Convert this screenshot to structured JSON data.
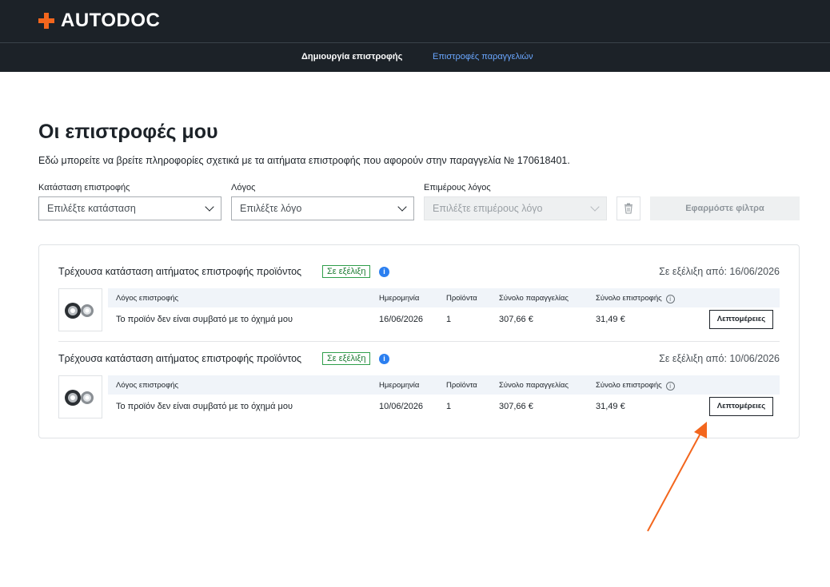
{
  "header": {
    "brand": "AUTODOC",
    "nav": {
      "create_return": "Δημιουργία επιστροφής",
      "order_returns": "Επιστροφές παραγγελιών"
    }
  },
  "page": {
    "title": "Οι επιστροφές μου",
    "description": "Εδώ μπορείτε να βρείτε πληροφορίες σχετικά με τα αιτήματα επιστροφής που αφορούν στην παραγγελία № 170618401."
  },
  "filters": {
    "status_label": "Κατάσταση επιστροφής",
    "status_placeholder": "Επιλέξτε κατάσταση",
    "reason_label": "Λόγος",
    "reason_placeholder": "Επιλέξτε λόγο",
    "subreason_label": "Επιμέρους λόγος",
    "subreason_placeholder": "Επιλέξτε επιμέρους λόγο",
    "apply_label": "Εφαρμόστε φίλτρα"
  },
  "columns": {
    "reason": "Λόγος επιστροφής",
    "date": "Ημερομηνία",
    "products": "Προϊόντα",
    "order_total": "Σύνολο παραγγελίας",
    "return_total": "Σύνολο επιστροφής"
  },
  "returns": [
    {
      "status_title": "Τρέχουσα κατάσταση αιτήματος επιστροφής προϊόντος",
      "status_badge": "Σε εξέλιξη",
      "since": "Σε εξέλιξη από: 16/06/2026",
      "reason": "Το προϊόν δεν είναι συμβατό με το όχημά μου",
      "date": "16/06/2026",
      "products": "1",
      "order_total": "307,66 €",
      "return_total": "31,49 €",
      "details_label": "Λεπτομέρειες"
    },
    {
      "status_title": "Τρέχουσα κατάσταση αιτήματος επιστροφής προϊόντος",
      "status_badge": "Σε εξέλιξη",
      "since": "Σε εξέλιξη από: 10/06/2026",
      "reason": "Το προϊόν δεν είναι συμβατό με το όχημά μου",
      "date": "10/06/2026",
      "products": "1",
      "order_total": "307,66 €",
      "return_total": "31,49 €",
      "details_label": "Λεπτομέρειες"
    }
  ],
  "colors": {
    "accent": "#f3661d",
    "header_bg": "#1c2228",
    "badge_green": "#2e9e4a",
    "info_blue": "#2b7ff0"
  },
  "icons": [
    "autodoc-plus-icon",
    "chevron-down-icon",
    "trash-icon",
    "info-icon",
    "wheel-bearing-icon",
    "arrow-annotation-icon"
  ]
}
